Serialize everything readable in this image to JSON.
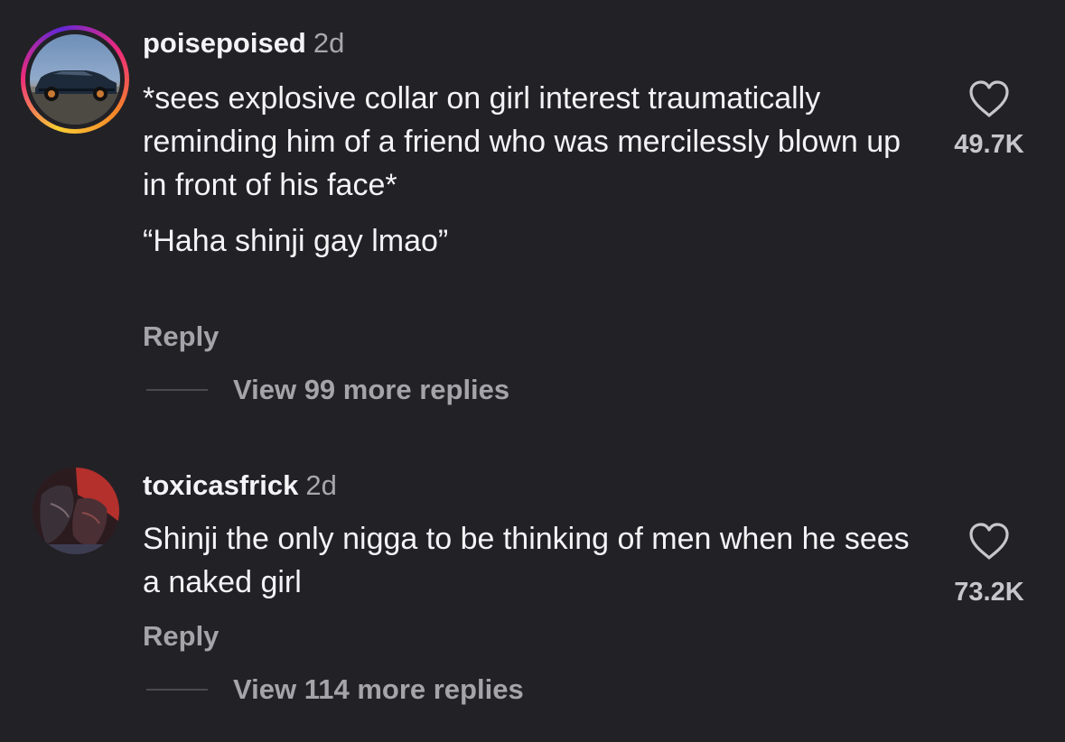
{
  "comments": [
    {
      "username": "poisepoised",
      "time": "2d",
      "text_paragraphs": [
        "*sees explosive collar on girl interest traumatically reminding him of a friend who was mercilessly blown up in front of his face*",
        "“Haha shinji gay lmao”"
      ],
      "reply_label": "Reply",
      "view_replies_label": "View 99 more replies",
      "like_count": "49.7K",
      "icons": {
        "like": "heart-outline-icon"
      },
      "avatar": {
        "has_story_ring": true
      }
    },
    {
      "username": "toxicasfrick",
      "time": "2d",
      "text_paragraphs": [
        "Shinji the only nigga to be thinking of men when he sees a naked girl"
      ],
      "reply_label": "Reply",
      "view_replies_label": "View 114 more replies",
      "like_count": "73.2K",
      "icons": {
        "like": "heart-outline-icon"
      },
      "avatar": {
        "has_story_ring": false
      }
    }
  ],
  "colors": {
    "background": "#222126",
    "primary_text": "#f4f4f6",
    "secondary_text": "#a4a4aa",
    "story_ring": [
      "#f9ce34",
      "#ee2a7b",
      "#6228d7"
    ]
  }
}
